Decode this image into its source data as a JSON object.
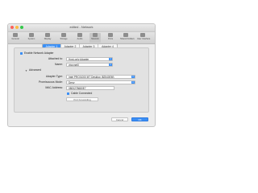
{
  "window": {
    "title": "edited - Network"
  },
  "toolbar": {
    "items": [
      {
        "label": "General"
      },
      {
        "label": "System"
      },
      {
        "label": "Display"
      },
      {
        "label": "Storage"
      },
      {
        "label": "Audio"
      },
      {
        "label": "Network"
      },
      {
        "label": "Ports"
      },
      {
        "label": "Shared Folders"
      },
      {
        "label": "User Interface"
      }
    ],
    "selected": "Network"
  },
  "tabs": [
    "Adapter 1",
    "Adapter 2",
    "Adapter 3",
    "Adapter 4"
  ],
  "form": {
    "enable_label": "Enable Network Adapter",
    "attached_label": "Attached to:",
    "attached_value": "Host-only Adapter",
    "name_label": "Name:",
    "name_value": "vboxnet0",
    "advanced_label": "Advanced",
    "adapter_type_label": "Adapter Type:",
    "adapter_type_value": "Intel PRO/1000 MT Desktop (82540EM)",
    "promiscuous_label": "Promiscuous Mode:",
    "promiscuous_value": "Deny",
    "mac_label": "MAC Address:",
    "mac_value": "0800278680E7",
    "cable_label": "Cable Connected",
    "port_forwarding_label": "Port Forwarding"
  },
  "buttons": {
    "cancel": "Cancel",
    "ok": "OK"
  },
  "colors": {
    "accent": "#3b8ff5"
  }
}
